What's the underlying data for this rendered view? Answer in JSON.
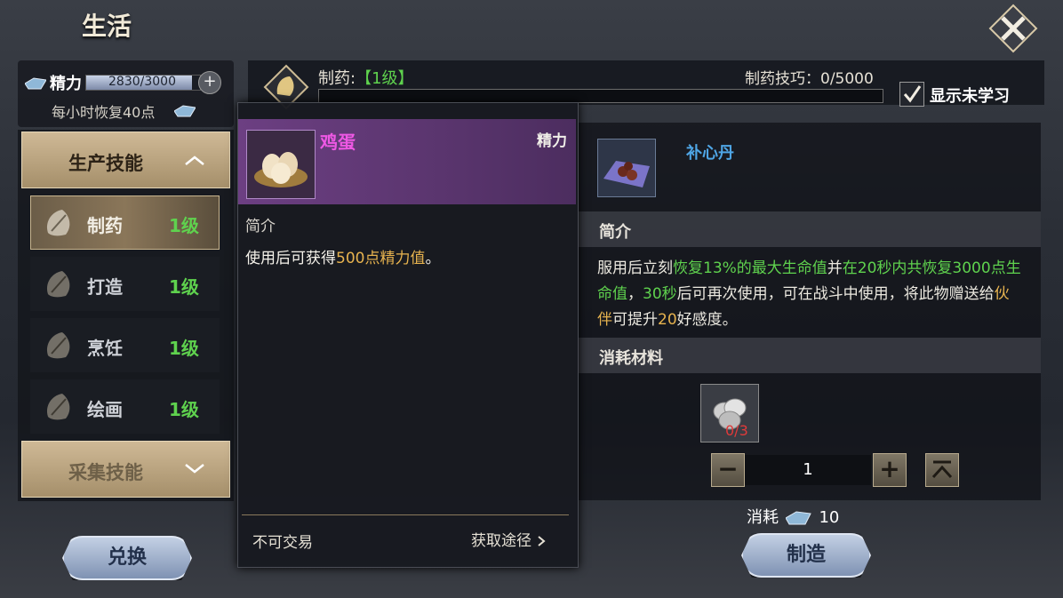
{
  "header": {
    "title": "生活"
  },
  "stamina": {
    "label": "精力",
    "value": "2830/3000",
    "fill": 0.943,
    "recover": "每小时恢复40点"
  },
  "categories": {
    "production": {
      "label": "生产技能"
    },
    "gathering": {
      "label": "采集技能"
    }
  },
  "skills": [
    {
      "name": "制药",
      "level": "1级"
    },
    {
      "name": "打造",
      "level": "1级"
    },
    {
      "name": "烹饪",
      "level": "1级"
    },
    {
      "name": "绘画",
      "level": "1级"
    }
  ],
  "buttons": {
    "exchange": "兑换",
    "craft": "制造"
  },
  "skill_header": {
    "name": "制药:",
    "level": "【1级】",
    "exp": "制药技巧：0/5000",
    "show_unlearned": "显示未学习"
  },
  "tooltip": {
    "name": "鸡蛋",
    "tag": "精力",
    "intro": "简介",
    "desc_pre": "使用后可获得",
    "desc_hl": "500点精力值",
    "desc_post": "。",
    "untradable": "不可交易",
    "source": "获取途径"
  },
  "item": {
    "name": "补心丹",
    "intro_label": "简介",
    "desc": [
      {
        "t": "服用后立刻",
        "c": ""
      },
      {
        "t": "恢复13%的最大生命值",
        "c": "g"
      },
      {
        "t": "并",
        "c": ""
      },
      {
        "t": "在20秒内共恢复3000点生命值",
        "c": "g"
      },
      {
        "t": "，",
        "c": ""
      },
      {
        "t": "30秒",
        "c": "g"
      },
      {
        "t": "后可再次使用，可在战斗中使用，将此物赠送给",
        "c": ""
      },
      {
        "t": "伙伴",
        "c": "y"
      },
      {
        "t": "可提升",
        "c": ""
      },
      {
        "t": "20",
        "c": "y"
      },
      {
        "t": "好感度。",
        "c": ""
      }
    ],
    "materials_label": "消耗材料",
    "material_count": "0/3",
    "quantity": "1",
    "cost_label": "消耗",
    "cost_value": "10"
  }
}
